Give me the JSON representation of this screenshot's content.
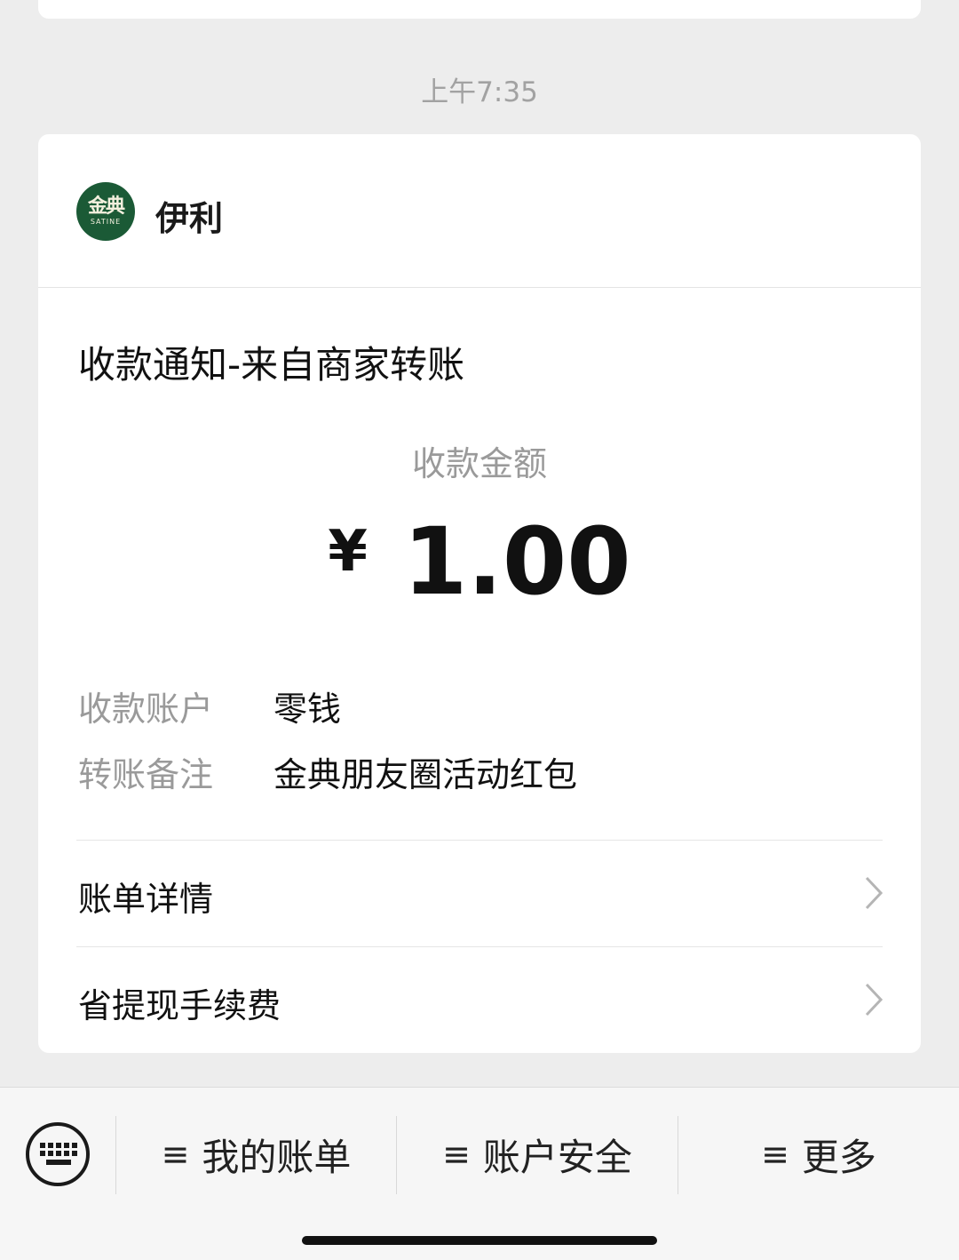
{
  "chat": {
    "time": "上午7:35"
  },
  "merchant": {
    "logo_text": "金典",
    "logo_subtext": "SATINE",
    "name": "伊利"
  },
  "notice": {
    "title": "收款通知-来自商家转账",
    "amount_label": "收款金额",
    "currency": "¥",
    "amount": "1.00",
    "details": [
      {
        "key": "收款账户",
        "value": "零钱"
      },
      {
        "key": "转账备注",
        "value": "金典朋友圈活动红包"
      }
    ],
    "links": [
      {
        "label": "账单详情"
      },
      {
        "label": "省提现手续费"
      }
    ]
  },
  "bottom_menu": {
    "items": [
      {
        "glyph": "≡",
        "label": "我的账单"
      },
      {
        "glyph": "≡",
        "label": "账户安全"
      },
      {
        "glyph": "≡",
        "label": "更多"
      }
    ]
  },
  "icons": {
    "keyboard": "keyboard-icon",
    "chevron": "chevron-right-icon",
    "menu": "menu-lines-icon"
  },
  "colors": {
    "background": "#ededed",
    "card": "#ffffff",
    "logo_green": "#1b5a36",
    "secondary_text": "#9a9a9a"
  }
}
